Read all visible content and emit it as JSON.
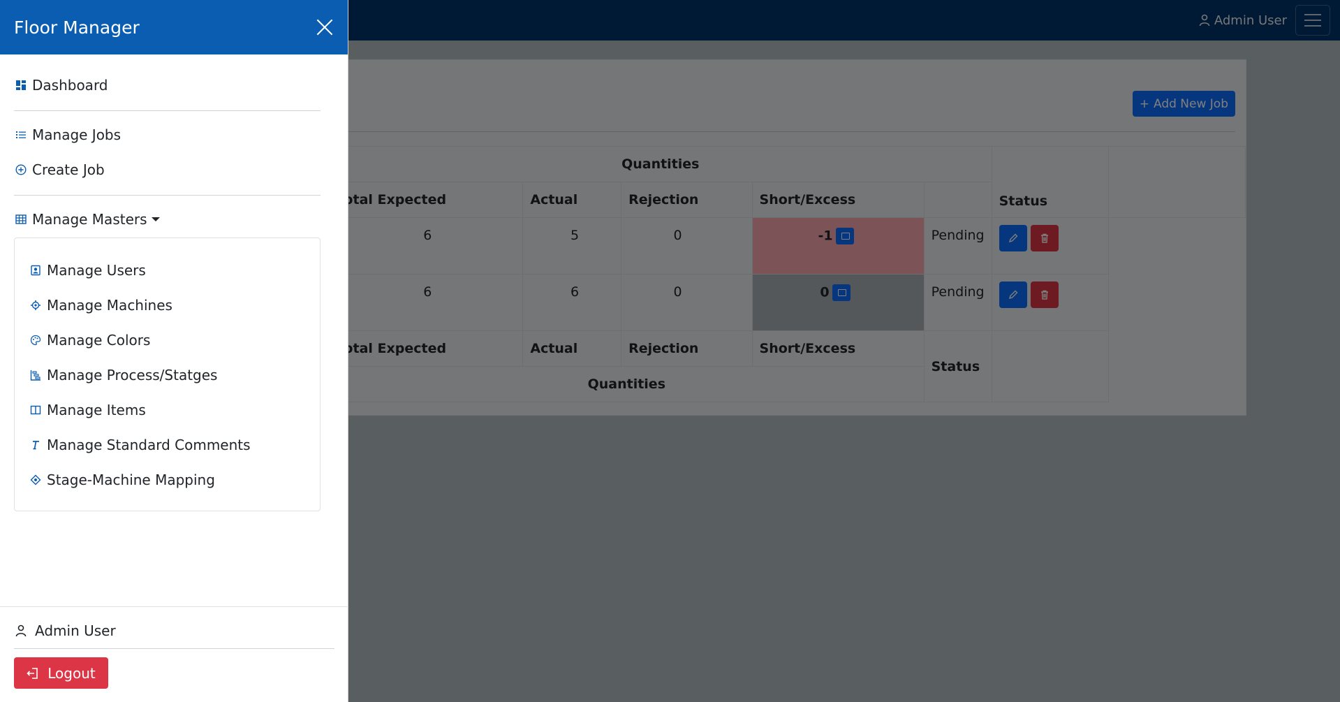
{
  "topbar": {
    "user_label": "Admin User"
  },
  "content": {
    "add_button_label": "Add New Job",
    "table": {
      "group_header": "Quantities",
      "columns": {
        "total_expected": "Total Expected",
        "actual": "Actual",
        "rejection": "Rejection",
        "short_excess": "Short/Excess",
        "status": "Status"
      },
      "rows": [
        {
          "total_expected": "6",
          "actual": "5",
          "rejection": "0",
          "short_excess": "-1",
          "status": "Pending"
        },
        {
          "total_expected": "6",
          "actual": "6",
          "rejection": "0",
          "short_excess": "0",
          "status": "Pending"
        }
      ]
    }
  },
  "sidebar": {
    "title": "Floor Manager",
    "dashboard": "Dashboard",
    "manage_jobs": "Manage Jobs",
    "create_job": "Create Job",
    "manage_masters": "Manage Masters",
    "masters_items": [
      "Manage Users",
      "Manage Machines",
      "Manage Colors",
      "Manage Process/Statges",
      "Manage Items",
      "Manage Standard Comments",
      "Stage-Machine Mapping"
    ],
    "footer_user": "Admin User",
    "logout_label": "Logout"
  },
  "colors": {
    "primary": "#0d6efd",
    "danger": "#dc3545",
    "navbar": "#00356b",
    "sidebar_header": "#0a5db0",
    "negative_cell": "#f8a8ae"
  }
}
